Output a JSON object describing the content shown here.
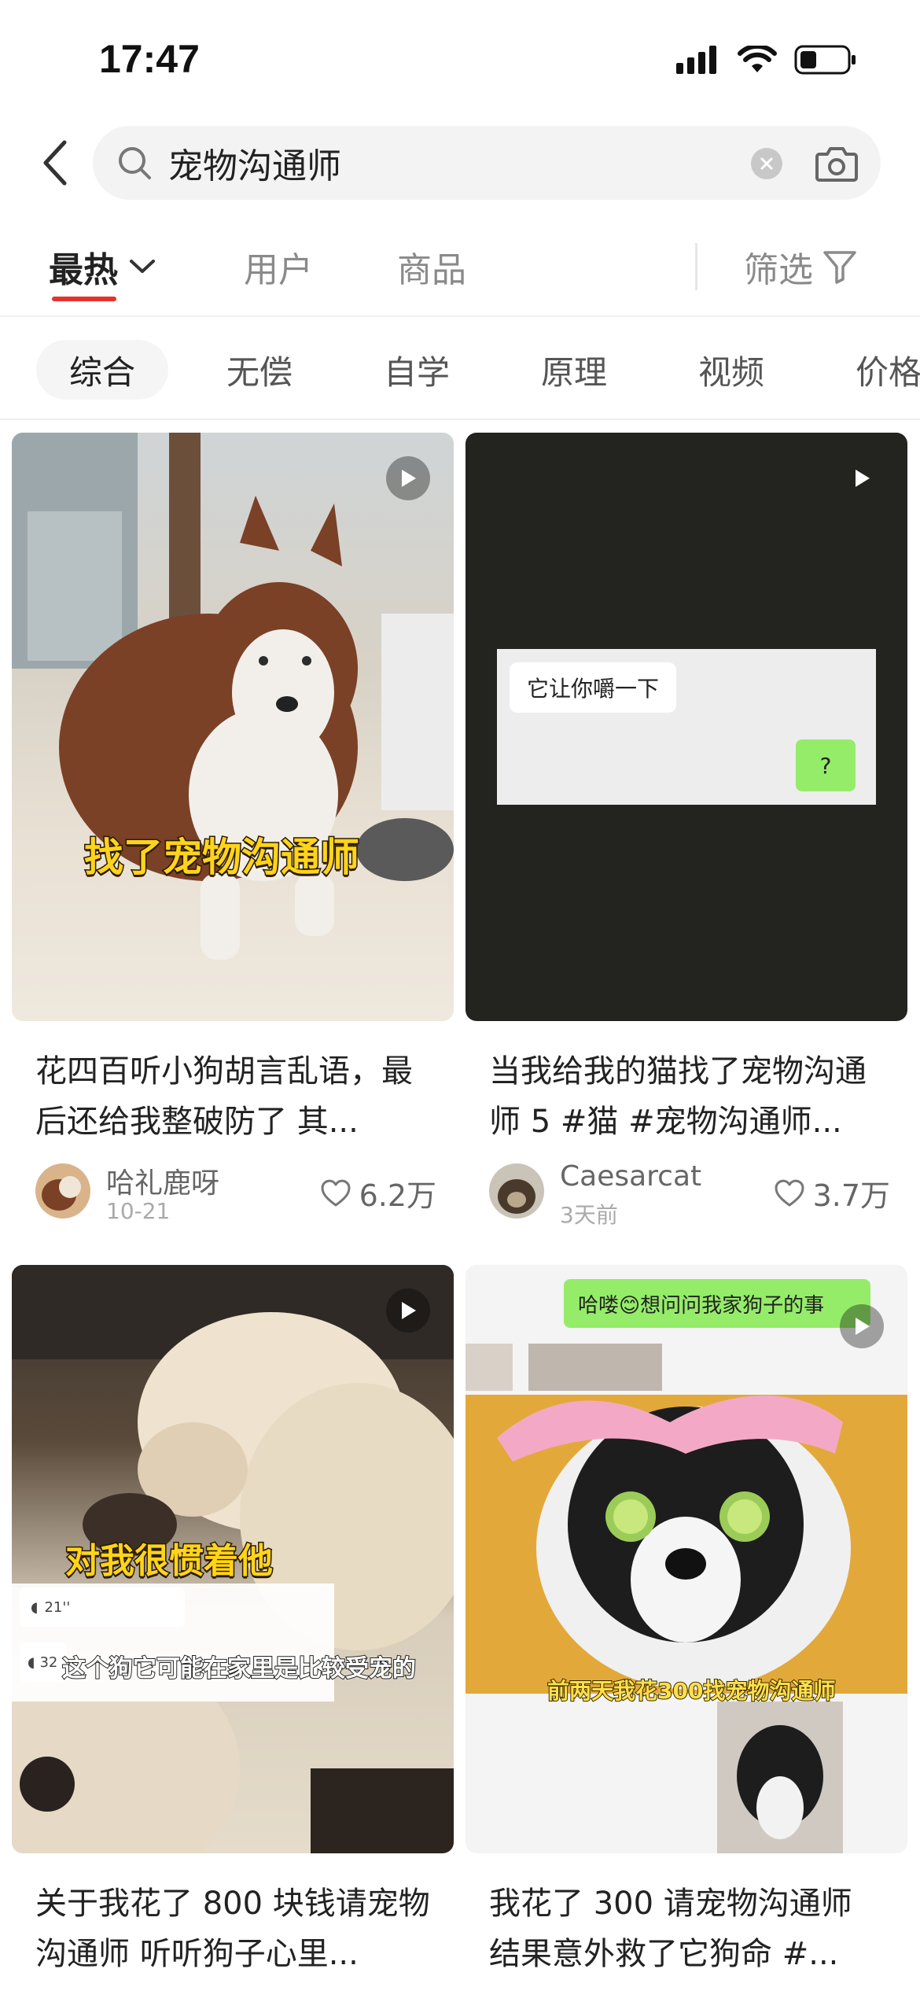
{
  "status_bar": {
    "time": "17:47"
  },
  "search": {
    "query": "宠物沟通师"
  },
  "tabs": {
    "hot": "最热",
    "users": "用户",
    "goods": "商品",
    "filter": "筛选"
  },
  "chips": [
    "综合",
    "无偿",
    "自学",
    "原理",
    "视频",
    "价格"
  ],
  "cards": [
    {
      "title": "花四百听小狗胡言乱语，最后还给我整破防了 其...",
      "author": "哈礼鹿呀",
      "date": "10-21",
      "likes": "6.2万",
      "overlay": "找了宠物沟通师"
    },
    {
      "title": "当我给我的猫找了宠物沟通师 5 #猫  #宠物沟通师...",
      "author": "Caesarcat",
      "date": "3天前",
      "likes": "3.7万",
      "chat_left": "它让你嚼一下",
      "chat_right": "?"
    },
    {
      "title": "关于我花了 800 块钱请宠物沟通师 听听狗子心里...",
      "overlay": "对我很惯着他",
      "voice_1": "21''",
      "voice_2": "32",
      "subtitle": "这个狗它可能在家里是比较受宠的"
    },
    {
      "title": "我花了 300 请宠物沟通师 结果意外救了它狗命 #...",
      "chat_top": "哈喽😊想问问我家狗子的事",
      "subtitle": "前两天我花300找宠物沟通师"
    }
  ],
  "colors": {
    "accent": "#e5322d",
    "chat_green": "#95ec69"
  }
}
